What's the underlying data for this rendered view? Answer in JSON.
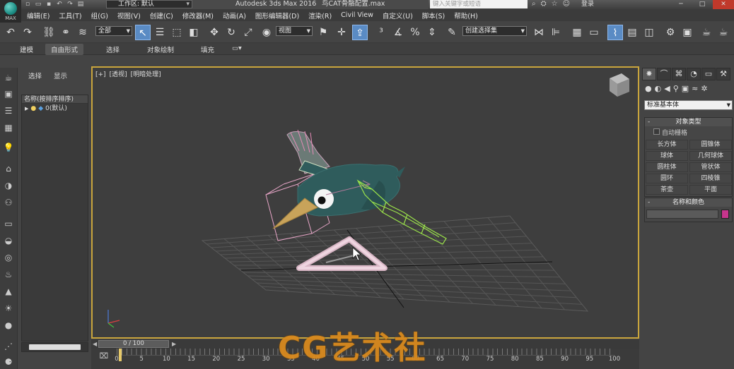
{
  "window": {
    "logo_label": "MAX",
    "workspace": "工作区: 默认",
    "app_title": "Autodesk 3ds Max 2016",
    "file_title": "鸟CAT骨骼配置.max",
    "search_placeholder": "键入关键字或短语",
    "login": "登录"
  },
  "menu": [
    "编辑(E)",
    "工具(T)",
    "组(G)",
    "视图(V)",
    "创建(C)",
    "修改器(M)",
    "动画(A)",
    "图形编辑器(D)",
    "渲染(R)",
    "Civil View",
    "自定义(U)",
    "脚本(S)",
    "帮助(H)"
  ],
  "toolbar": {
    "selection_filter": "全部",
    "reference_coord": "视图",
    "named_selection": "创建选择集"
  },
  "ribbon": {
    "tabs": [
      "建模",
      "自由形式",
      "选择",
      "对象绘制",
      "填充"
    ]
  },
  "explorer": {
    "tabs": [
      "选择",
      "显示"
    ],
    "column_header": "名称(按排序排序)",
    "rows": [
      {
        "label": "0(默认)"
      }
    ]
  },
  "viewport": {
    "label_parts": [
      "[+]",
      "[透视]",
      "[明暗处理]"
    ]
  },
  "timeline": {
    "frame_display": "0 / 100",
    "ticks": [
      "0",
      "5",
      "10",
      "15",
      "20",
      "25",
      "30",
      "35",
      "40",
      "45",
      "50",
      "55",
      "60",
      "65",
      "70",
      "75",
      "80",
      "85",
      "90",
      "95",
      "100"
    ]
  },
  "command_panel": {
    "category_dropdown": "标准基本体",
    "object_type_title": "对象类型",
    "autogrid_label": "自动栅格",
    "object_buttons": [
      "长方体",
      "圆锥体",
      "球体",
      "几何球体",
      "圆柱体",
      "管状体",
      "圆环",
      "四棱锥",
      "茶壶",
      "平面"
    ],
    "name_color_title": "名称和颜色",
    "object_color": "#c8358d"
  },
  "watermark": "CG艺术社",
  "colors": {
    "viewport_border": "#c9a53c",
    "bird_body": "#2f5c5c",
    "selection_box": "#e8a6c8",
    "bone_green": "#9be34a"
  }
}
